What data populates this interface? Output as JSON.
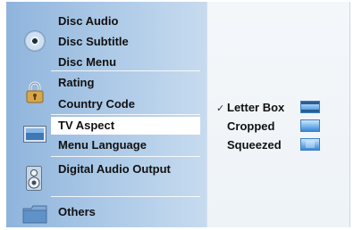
{
  "menu": {
    "group_disc": {
      "icon": "disc-icon",
      "items": [
        "Disc Audio",
        "Disc Subtitle",
        "Disc Menu"
      ]
    },
    "group_lock": {
      "icon": "lock-icon",
      "items": [
        "Rating",
        "Country Code"
      ]
    },
    "group_tv": {
      "icon": "tv-icon",
      "items": [
        "TV Aspect",
        "Menu Language"
      ],
      "selected": "TV Aspect"
    },
    "group_audio": {
      "icon": "speaker-icon",
      "items": [
        "Digital Audio Output"
      ]
    },
    "group_others": {
      "icon": "folder-icon",
      "items": [
        "Others"
      ]
    }
  },
  "tv_aspect_options": [
    {
      "label": "Letter Box",
      "checked": true,
      "icon": "letterbox-icon"
    },
    {
      "label": "Cropped",
      "checked": false,
      "icon": "cropped-icon"
    },
    {
      "label": "Squeezed",
      "checked": false,
      "icon": "squeezed-icon"
    }
  ],
  "check_mark": "✓",
  "colors": {
    "sidebar_start": "#8fb4dc",
    "sidebar_end": "#c7dbef",
    "selected_bg": "#ffffff",
    "panel_bg": "#f4f7fa"
  }
}
